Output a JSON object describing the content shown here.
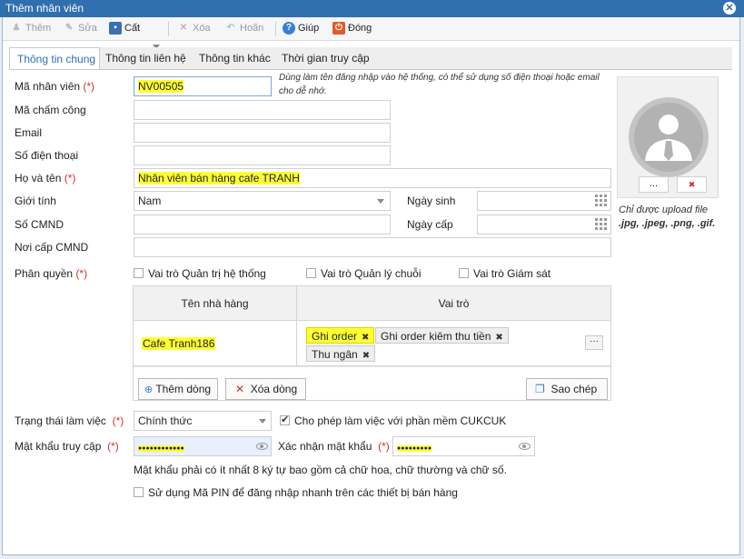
{
  "window": {
    "title": "Thêm nhân viên"
  },
  "toolbar": {
    "add": "Thêm",
    "edit": "Sửa",
    "save": "Cất",
    "delete": "Xóa",
    "undo": "Hoãn",
    "help": "Giúp",
    "close": "Đóng"
  },
  "tabs": [
    "Thông tin chung",
    "Thông tin liên hệ",
    "Thông tin khác",
    "Thời gian truy cập"
  ],
  "form": {
    "employee_code": {
      "label": "Mã nhân viên",
      "req": "(*)",
      "value": "NV00505"
    },
    "hint": "Dùng làm tên đăng nhập vào hệ thống, có thể sử dụng số điện thoại hoặc email cho dễ nhớ.",
    "timekeeping_code": {
      "label": "Mã chấm công",
      "value": ""
    },
    "email": {
      "label": "Email",
      "value": ""
    },
    "phone": {
      "label": "Số điện thoại",
      "value": ""
    },
    "full_name": {
      "label": "Họ và tên",
      "req": "(*)",
      "value": "Nhân viên bán hàng cafe TRANH"
    },
    "gender": {
      "label": "Giới tính",
      "value": "Nam"
    },
    "birth_date": {
      "label": "Ngày sinh",
      "value": ""
    },
    "id_number": {
      "label": "Số CMND",
      "value": ""
    },
    "issue_date": {
      "label": "Ngày cấp",
      "value": ""
    },
    "issue_place": {
      "label": "Nơi cấp CMND",
      "value": ""
    },
    "roles": {
      "label": "Phân quyền",
      "req": "(*)",
      "options": [
        "Vai trò Quản trị hệ thống",
        "Vai trò Quản lý chuỗi",
        "Vai trò Giám sát"
      ]
    },
    "grid": {
      "col_restaurant": "Tên nhà hàng",
      "col_role": "Vai trò",
      "row": {
        "restaurant": "Cafe Tranh186",
        "chips": [
          "Ghi order",
          "Ghi order kiêm thu tiền",
          "Thu ngân"
        ],
        "more": "···"
      },
      "add_row": "Thêm dòng",
      "delete_row": "Xóa dòng",
      "copy": "Sao chép"
    },
    "work_status": {
      "label": "Trạng thái làm việc",
      "req": "(*)",
      "value": "Chính thức"
    },
    "allow_cukcuk": "Cho phép làm việc với phần mềm CUKCUK",
    "password": {
      "label": "Mật khẩu truy cập",
      "req": "(*)",
      "value": "●●●●●●●●●●●●"
    },
    "confirm_password": {
      "label": "Xác nhận mật khẩu",
      "req": "(*)",
      "value": "●●●●●●●●●"
    },
    "password_hint": "Mật khẩu phải có ít nhất 8 ký tự bao gồm cả chữ hoa, chữ thường và chữ số.",
    "pin_option": "Sử dụng Mã PIN để đăng nhập nhanh trên các thiết bị bán hàng"
  },
  "avatar": {
    "browse": "...",
    "remove": "✖",
    "note_line1": "Chỉ được upload file",
    "note_line2": ".jpg, .jpeg, .png, .gif."
  },
  "colors": {
    "titlebar": "#2f6fb0",
    "highlight": "#ffff33",
    "required": "#d32f2f"
  }
}
